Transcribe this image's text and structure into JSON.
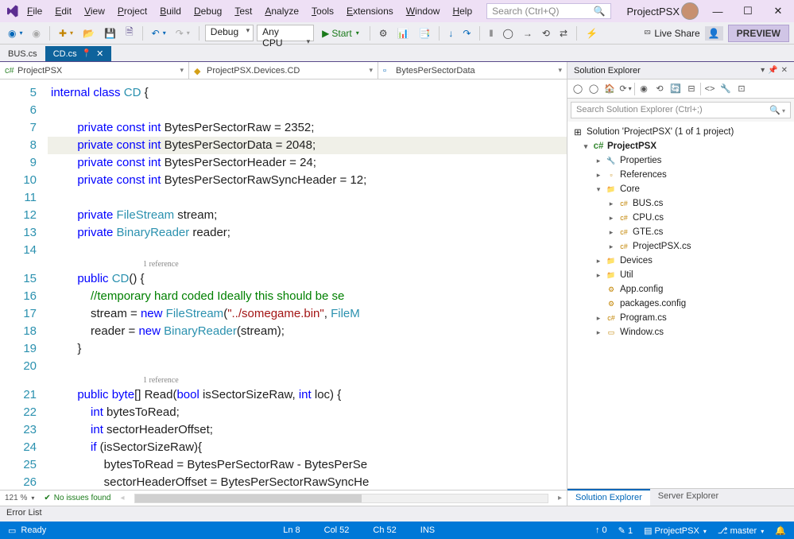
{
  "title": {
    "app_name": "ProjectPSX",
    "search_placeholder": "Search (Ctrl+Q)"
  },
  "menu": [
    "File",
    "Edit",
    "View",
    "Project",
    "Build",
    "Debug",
    "Test",
    "Analyze",
    "Tools",
    "Extensions",
    "Window",
    "Help"
  ],
  "toolbar": {
    "config": "Debug",
    "platform": "Any CPU",
    "start": "Start",
    "live_share": "Live Share",
    "preview": "PREVIEW"
  },
  "doc_tabs": [
    {
      "label": "BUS.cs",
      "active": false
    },
    {
      "label": "CD.cs",
      "active": true
    }
  ],
  "navbar": {
    "project": "ProjectPSX",
    "scope": "ProjectPSX.Devices.CD",
    "member": "BytesPerSectorData"
  },
  "code": {
    "lines": [
      {
        "n": 5,
        "t": "    internal class CD {",
        "tok": [
          [
            "kw",
            "internal"
          ],
          [
            "",
            " "
          ],
          [
            "kw",
            "class"
          ],
          [
            "",
            " "
          ],
          [
            "cls",
            "CD"
          ],
          [
            "",
            " {"
          ]
        ]
      },
      {
        "n": 6,
        "t": "",
        "tok": [
          [
            "",
            ""
          ]
        ]
      },
      {
        "n": 7,
        "t": "        private const int BytesPerSectorRaw = 2352;",
        "tok": [
          [
            "kw",
            "        private"
          ],
          [
            "",
            " "
          ],
          [
            "kw",
            "const"
          ],
          [
            "",
            " "
          ],
          [
            "kw",
            "int"
          ],
          [
            "",
            " BytesPerSectorRaw = 2352;"
          ]
        ]
      },
      {
        "n": 8,
        "hl": true,
        "glyph": "✎",
        "t": "        private const int BytesPerSectorData = 2048;",
        "tok": [
          [
            "kw",
            "        private"
          ],
          [
            "",
            " "
          ],
          [
            "kw",
            "const"
          ],
          [
            "",
            " "
          ],
          [
            "kw",
            "int"
          ],
          [
            "",
            " BytesPerSectorData = 2048;"
          ]
        ]
      },
      {
        "n": 9,
        "t": "        private const int BytesPerSectorHeader = 24;",
        "tok": [
          [
            "kw",
            "        private"
          ],
          [
            "",
            " "
          ],
          [
            "kw",
            "const"
          ],
          [
            "",
            " "
          ],
          [
            "kw",
            "int"
          ],
          [
            "",
            " BytesPerSectorHeader = 24;"
          ]
        ]
      },
      {
        "n": 10,
        "t": "        private const int BytesPerSectorRawSyncHeader = 12;",
        "tok": [
          [
            "kw",
            "        private"
          ],
          [
            "",
            " "
          ],
          [
            "kw",
            "const"
          ],
          [
            "",
            " "
          ],
          [
            "kw",
            "int"
          ],
          [
            "",
            " BytesPerSectorRawSyncHeader = 12;"
          ]
        ]
      },
      {
        "n": 11,
        "t": "",
        "tok": [
          [
            "",
            ""
          ]
        ]
      },
      {
        "n": 12,
        "t": "        private FileStream stream;",
        "tok": [
          [
            "kw",
            "        private"
          ],
          [
            "",
            " "
          ],
          [
            "cls",
            "FileStream"
          ],
          [
            "",
            " "
          ],
          [
            "",
            "stream"
          ],
          [
            "",
            ";"
          ]
        ]
      },
      {
        "n": 13,
        "t": "        private BinaryReader reader;",
        "tok": [
          [
            "kw",
            "        private"
          ],
          [
            "",
            " "
          ],
          [
            "cls",
            "BinaryReader"
          ],
          [
            "",
            " "
          ],
          [
            "",
            "reader"
          ],
          [
            "",
            ";"
          ]
        ]
      },
      {
        "n": 14,
        "t": "",
        "tok": [
          [
            "",
            ""
          ]
        ]
      },
      {
        "ref": "1 reference"
      },
      {
        "n": 15,
        "ol": "-",
        "t": "        public CD() {",
        "tok": [
          [
            "kw",
            "        public"
          ],
          [
            "",
            " "
          ],
          [
            "cls",
            "CD"
          ],
          [
            "",
            "() {"
          ]
        ]
      },
      {
        "n": 16,
        "t": "            //temporary hard coded Ideally this should be se",
        "tok": [
          [
            "",
            "            "
          ],
          [
            "cmt",
            "//temporary hard coded Ideally this should be se"
          ]
        ]
      },
      {
        "n": 17,
        "cb": "green",
        "t": "            stream = new FileStream(\"../somegame.bin\", FileM",
        "tok": [
          [
            "",
            "            stream = "
          ],
          [
            "kw",
            "new"
          ],
          [
            "",
            " "
          ],
          [
            "cls",
            "FileStream"
          ],
          [
            "",
            "("
          ],
          [
            "str",
            "\"../somegame.bin\""
          ],
          [
            "",
            ", "
          ],
          [
            "cls",
            "FileM"
          ]
        ]
      },
      {
        "n": 18,
        "t": "            reader = new BinaryReader(stream);",
        "tok": [
          [
            "",
            "            reader = "
          ],
          [
            "kw",
            "new"
          ],
          [
            "",
            " "
          ],
          [
            "cls",
            "BinaryReader"
          ],
          [
            "",
            "(stream);"
          ]
        ]
      },
      {
        "n": 19,
        "t": "        }",
        "tok": [
          [
            "",
            "        }"
          ]
        ]
      },
      {
        "n": 20,
        "t": "",
        "tok": [
          [
            "",
            ""
          ]
        ]
      },
      {
        "ref": "1 reference"
      },
      {
        "n": 21,
        "ol": "-",
        "t": "        public byte[] Read(bool isSectorSizeRaw, int loc) {",
        "tok": [
          [
            "kw",
            "        public"
          ],
          [
            "",
            " "
          ],
          [
            "kw",
            "byte"
          ],
          [
            "",
            "[] "
          ],
          [
            "",
            "Read"
          ],
          [
            "",
            "("
          ],
          [
            "kw",
            "bool"
          ],
          [
            "",
            " isSectorSizeRaw, "
          ],
          [
            "kw",
            "int"
          ],
          [
            "",
            " loc) {"
          ]
        ]
      },
      {
        "n": 22,
        "t": "            int bytesToRead;",
        "tok": [
          [
            "",
            "            "
          ],
          [
            "kw",
            "int"
          ],
          [
            "",
            " bytesToRead;"
          ]
        ]
      },
      {
        "n": 23,
        "t": "            int sectorHeaderOffset;",
        "tok": [
          [
            "",
            "            "
          ],
          [
            "kw",
            "int"
          ],
          [
            "",
            " sectorHeaderOffset;"
          ]
        ]
      },
      {
        "n": 24,
        "t": "            if (isSectorSizeRaw){",
        "tok": [
          [
            "",
            "            "
          ],
          [
            "kw",
            "if"
          ],
          [
            "",
            " (isSectorSizeRaw){"
          ]
        ]
      },
      {
        "n": 25,
        "t": "                bytesToRead = BytesPerSectorRaw - BytesPerSe",
        "tok": [
          [
            "",
            "                bytesToRead = BytesPerSectorRaw - BytesPerSe"
          ]
        ]
      },
      {
        "n": 26,
        "t": "                sectorHeaderOffset = BytesPerSectorRawSyncHe",
        "tok": [
          [
            "",
            "                sectorHeaderOffset = BytesPerSectorRawSyncHe"
          ]
        ]
      }
    ]
  },
  "editor_footer": {
    "zoom": "121 %",
    "issues": "No issues found"
  },
  "solution": {
    "title": "Solution Explorer",
    "search_placeholder": "Search Solution Explorer (Ctrl+;)",
    "root": "Solution 'ProjectPSX' (1 of 1 project)",
    "project": "ProjectPSX",
    "nodes": [
      {
        "l": "Properties",
        "d": 2,
        "exp": "▸",
        "icn": "🔧"
      },
      {
        "l": "References",
        "d": 2,
        "exp": "▸",
        "icn": "▫"
      },
      {
        "l": "Core",
        "d": 2,
        "exp": "▾",
        "icn": "📁"
      },
      {
        "l": "BUS.cs",
        "d": 3,
        "exp": "▸",
        "icn": "c#"
      },
      {
        "l": "CPU.cs",
        "d": 3,
        "exp": "▸",
        "icn": "c#"
      },
      {
        "l": "GTE.cs",
        "d": 3,
        "exp": "▸",
        "icn": "c#"
      },
      {
        "l": "ProjectPSX.cs",
        "d": 3,
        "exp": "▸",
        "icn": "c#"
      },
      {
        "l": "Devices",
        "d": 2,
        "exp": "▸",
        "icn": "📁"
      },
      {
        "l": "Util",
        "d": 2,
        "exp": "▸",
        "icn": "📁"
      },
      {
        "l": "App.config",
        "d": 2,
        "exp": "",
        "icn": "⚙"
      },
      {
        "l": "packages.config",
        "d": 2,
        "exp": "",
        "icn": "⚙"
      },
      {
        "l": "Program.cs",
        "d": 2,
        "exp": "▸",
        "icn": "c#"
      },
      {
        "l": "Window.cs",
        "d": 2,
        "exp": "▸",
        "icn": "▭"
      }
    ],
    "tabs": [
      "Solution Explorer",
      "Server Explorer"
    ]
  },
  "errorlist": "Error List",
  "status": {
    "ready": "Ready",
    "line": "Ln 8",
    "col": "Col 52",
    "ch": "Ch 52",
    "ins": "INS",
    "up": "0",
    "pencil": "1",
    "repo": "ProjectPSX",
    "branch": "master"
  }
}
